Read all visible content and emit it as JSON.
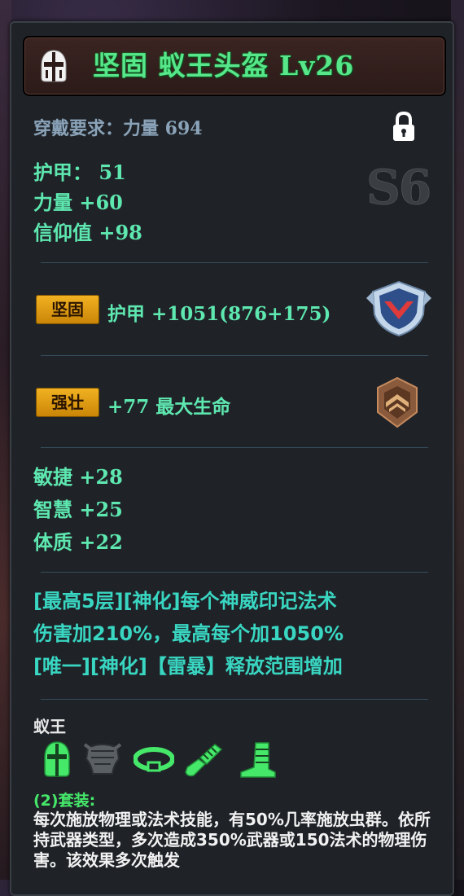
{
  "item": {
    "title": "坚固  蚁王头盔  Lv26",
    "icon": "helmet-icon",
    "locked": true,
    "lock_icon": "lock-icon",
    "grade": "S6",
    "colors": {
      "title": "#58e68a",
      "stat": "#5ee8b0",
      "desc": "#39d6c2",
      "badge": "#f2b323"
    }
  },
  "requirement": "穿戴要求：力量  694",
  "base_stats": [
    "护甲：  51",
    "力量  +60",
    "信仰值  +98"
  ],
  "affixes": [
    {
      "badge": "坚固",
      "text": "护甲  +1051(876+175)",
      "icon": "shield-rune-icon"
    },
    {
      "badge": "强壮",
      "text": "+77  最大生命",
      "icon": "bronze-rune-icon"
    }
  ],
  "extra_stats": [
    "敏捷  +28",
    "智慧  +25",
    "体质  +22"
  ],
  "special_lines": [
    "[最高5层][神化]每个神威印记法术",
    "伤害加210%，最高每个加1050%",
    "[唯一][神化]【雷暴】释放范围增加"
  ],
  "set": {
    "name": "蚁王",
    "pieces": [
      {
        "icon": "helmet-icon",
        "owned": true
      },
      {
        "icon": "shoulder-armor-icon",
        "owned": false
      },
      {
        "icon": "belt-icon",
        "owned": true
      },
      {
        "icon": "gauntlet-icon",
        "owned": true
      },
      {
        "icon": "boots-icon",
        "owned": true
      }
    ],
    "bonus_label": "(2)套装:",
    "bonus_desc": "每次施放物理或法术技能，有50%几率施放虫群。依所持武器类型，多次造成350%武器或150法术的物理伤害。该效果多次触发"
  }
}
